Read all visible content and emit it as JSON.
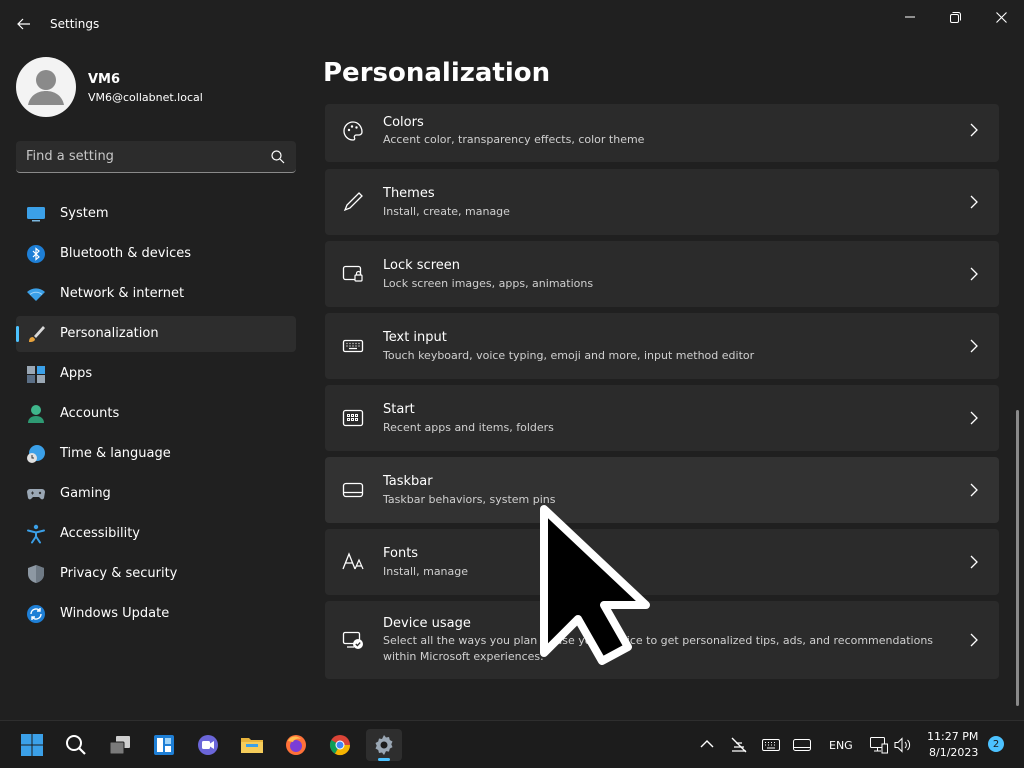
{
  "window": {
    "title": "Settings"
  },
  "profile": {
    "name": "VM6",
    "email": "VM6@collabnet.local"
  },
  "search": {
    "placeholder": "Find a setting"
  },
  "sidebar": {
    "items": [
      {
        "label": "System",
        "icon": "monitor-icon"
      },
      {
        "label": "Bluetooth & devices",
        "icon": "bluetooth-icon"
      },
      {
        "label": "Network & internet",
        "icon": "wifi-icon"
      },
      {
        "label": "Personalization",
        "icon": "brush-icon",
        "selected": true
      },
      {
        "label": "Apps",
        "icon": "apps-icon"
      },
      {
        "label": "Accounts",
        "icon": "person-icon"
      },
      {
        "label": "Time & language",
        "icon": "globe-clock-icon"
      },
      {
        "label": "Gaming",
        "icon": "gamepad-icon"
      },
      {
        "label": "Accessibility",
        "icon": "accessibility-icon"
      },
      {
        "label": "Privacy & security",
        "icon": "shield-icon"
      },
      {
        "label": "Windows Update",
        "icon": "update-icon"
      }
    ]
  },
  "main": {
    "title": "Personalization",
    "cards": [
      {
        "title": "Colors",
        "subtitle": "Accent color, transparency effects, color theme",
        "icon": "palette-icon"
      },
      {
        "title": "Themes",
        "subtitle": "Install, create, manage",
        "icon": "pen-icon"
      },
      {
        "title": "Lock screen",
        "subtitle": "Lock screen images, apps, animations",
        "icon": "lock-screen-icon"
      },
      {
        "title": "Text input",
        "subtitle": "Touch keyboard, voice typing, emoji and more, input method editor",
        "icon": "keyboard-icon"
      },
      {
        "title": "Start",
        "subtitle": "Recent apps and items, folders",
        "icon": "start-icon"
      },
      {
        "title": "Taskbar",
        "subtitle": "Taskbar behaviors, system pins",
        "icon": "taskbar-icon"
      },
      {
        "title": "Fonts",
        "subtitle": "Install, manage",
        "icon": "fonts-icon"
      },
      {
        "title": "Device usage",
        "subtitle": "Select all the ways you plan to use your device to get personalized tips, ads, and recommendations within Microsoft experiences.",
        "icon": "device-usage-icon"
      }
    ]
  },
  "taskbar": {
    "language": "ENG",
    "time": "11:27 PM",
    "date": "8/1/2023",
    "notifications": "2"
  },
  "colors": {
    "accent": "#4cc2ff",
    "background": "#202020",
    "card": "#2b2b2b"
  }
}
